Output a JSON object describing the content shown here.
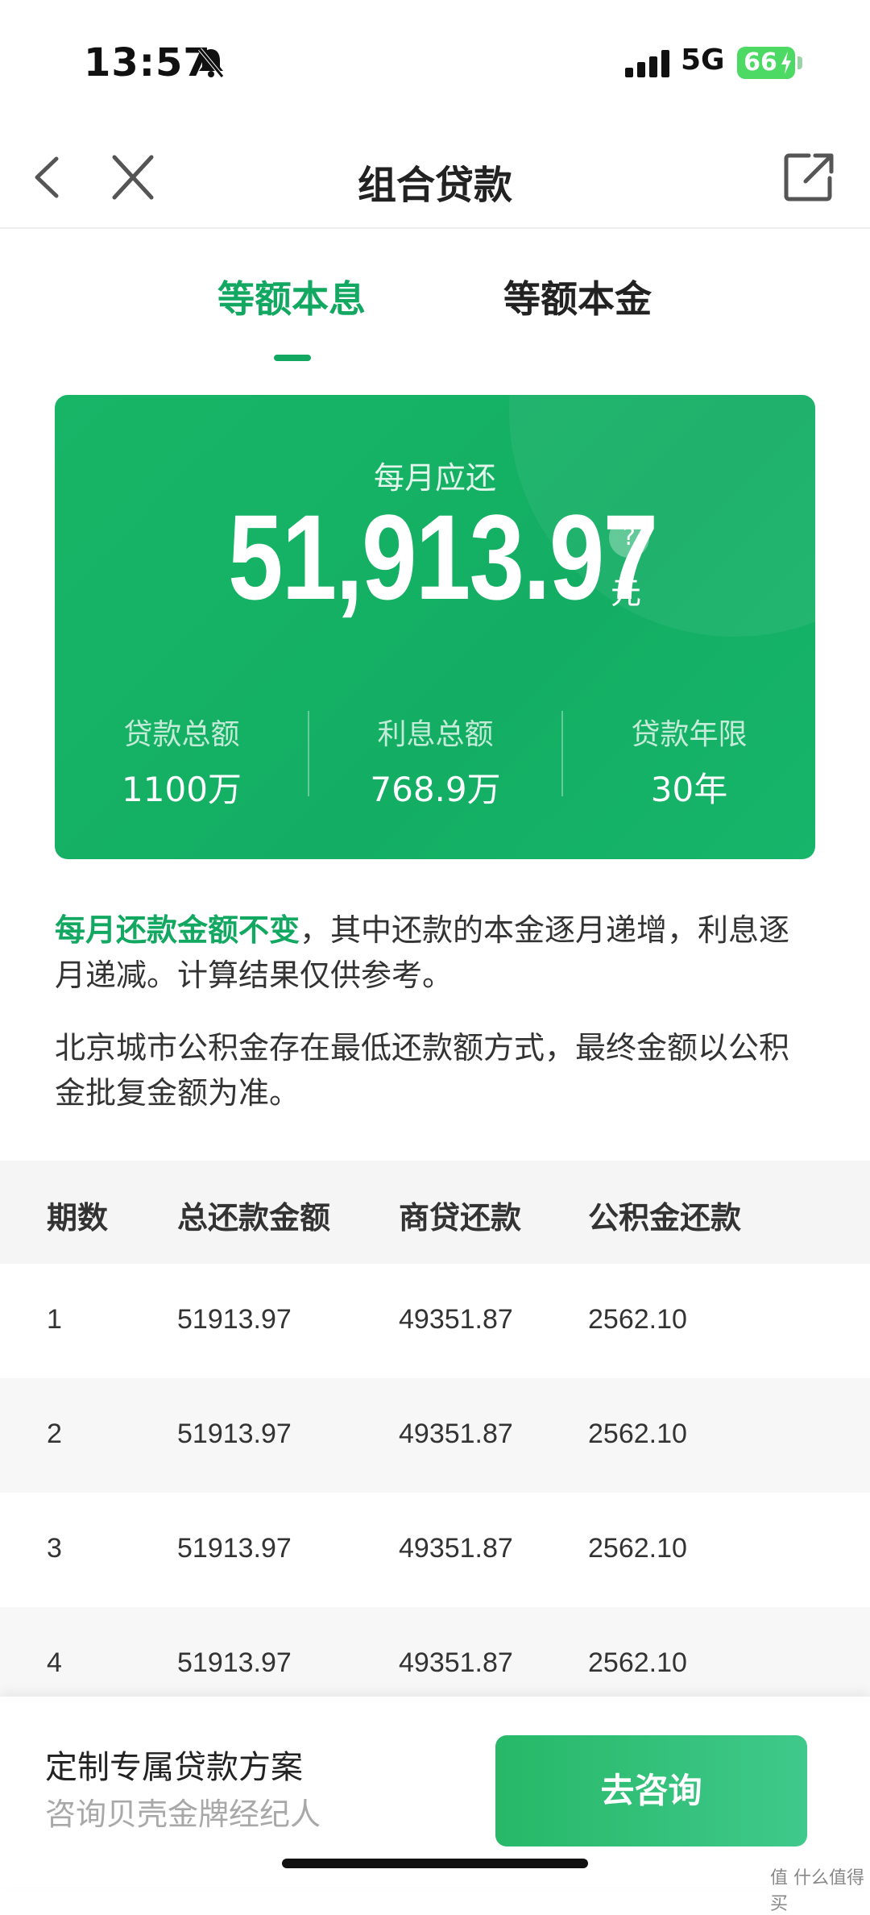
{
  "status_bar": {
    "time": "13:57",
    "network": "5G",
    "battery": "66"
  },
  "nav": {
    "title": "组合贷款"
  },
  "tabs": [
    {
      "label": "等额本息",
      "active": true
    },
    {
      "label": "等额本金",
      "active": false
    }
  ],
  "summary": {
    "monthly_label": "每月应还",
    "monthly_amount": "51,913.97",
    "help": "?",
    "unit": "元",
    "stats": [
      {
        "label": "贷款总额",
        "value": "1100万"
      },
      {
        "label": "利息总额",
        "value": "768.9万"
      },
      {
        "label": "贷款年限",
        "value": "30年"
      }
    ]
  },
  "notes": {
    "highlight": "每月还款金额不变",
    "rest": "，其中还款的本金逐月递增，利息逐月递减。计算结果仅供参考。",
    "second": "北京城市公积金存在最低还款额方式，最终金额以公积金批复金额为准。"
  },
  "table": {
    "headers": [
      "期数",
      "总还款金额",
      "商贷还款",
      "公积金还款"
    ],
    "rows": [
      [
        "1",
        "51913.97",
        "49351.87",
        "2562.10"
      ],
      [
        "2",
        "51913.97",
        "49351.87",
        "2562.10"
      ],
      [
        "3",
        "51913.97",
        "49351.87",
        "2562.10"
      ],
      [
        "4",
        "51913.97",
        "49351.87",
        "2562.10"
      ]
    ]
  },
  "footer": {
    "title": "定制专属贷款方案",
    "subtitle": "咨询贝壳金牌经纪人",
    "button": "去咨询"
  },
  "watermark": "值 什么值得买",
  "colors": {
    "accent": "#13a862",
    "card": "#15b064"
  }
}
